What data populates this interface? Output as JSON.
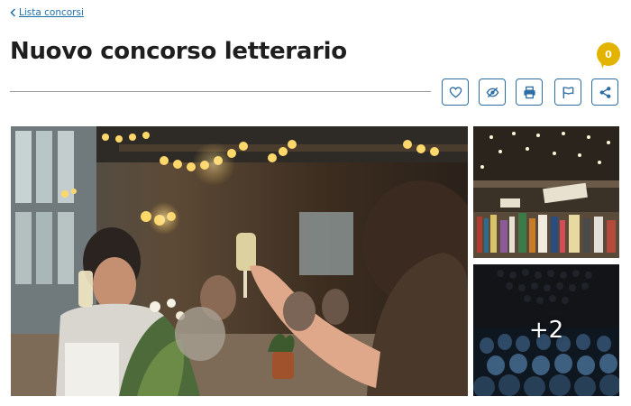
{
  "breadcrumb": {
    "back_label": "Lista concorsi"
  },
  "header": {
    "title": "Nuovo concorso letterario",
    "counter": "0"
  },
  "colors": {
    "link": "#1e6fa8",
    "button_border": "#2d6da3",
    "badge": "#e2b400"
  },
  "actions": [
    {
      "icon": "heart-icon"
    },
    {
      "icon": "eye-slash-icon"
    },
    {
      "icon": "printer-icon"
    },
    {
      "icon": "flag-icon"
    },
    {
      "icon": "share-icon"
    }
  ],
  "gallery": {
    "main_image": "banquet-toast-photo",
    "thumbnails": [
      "bookstore-photo",
      "conference-audience-photo"
    ],
    "more_label": "+2"
  }
}
